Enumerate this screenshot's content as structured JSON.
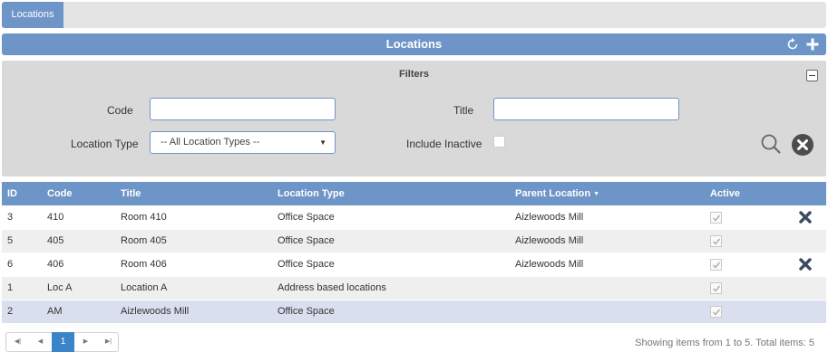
{
  "tabbar": {
    "tabs": [
      {
        "label": "Locations"
      }
    ]
  },
  "header": {
    "title": "Locations",
    "refresh_icon": "refresh-icon",
    "add_icon": "plus-icon"
  },
  "filters": {
    "title": "Filters",
    "code_label": "Code",
    "code_value": "",
    "title_label": "Title",
    "title_value": "",
    "location_type_label": "Location Type",
    "location_type_selected": "-- All Location Types --",
    "include_inactive_label": "Include Inactive",
    "include_inactive_checked": false
  },
  "grid": {
    "columns": [
      "ID",
      "Code",
      "Title",
      "Location Type",
      "Parent Location",
      "Active"
    ],
    "sorted_column": "Parent Location",
    "rows": [
      {
        "id": "3",
        "code": "410",
        "title": "Room 410",
        "type": "Office Space",
        "parent": "Aizlewoods Mill",
        "active": true,
        "deletable": true
      },
      {
        "id": "5",
        "code": "405",
        "title": "Room 405",
        "type": "Office Space",
        "parent": "Aizlewoods Mill",
        "active": true,
        "deletable": false
      },
      {
        "id": "6",
        "code": "406",
        "title": "Room 406",
        "type": "Office Space",
        "parent": "Aizlewoods Mill",
        "active": true,
        "deletable": true
      },
      {
        "id": "1",
        "code": "Loc A",
        "title": "Location A",
        "type": "Address based locations",
        "parent": "",
        "active": true,
        "deletable": false
      },
      {
        "id": "2",
        "code": "AM",
        "title": "Aizlewoods Mill",
        "type": "Office Space",
        "parent": "",
        "active": true,
        "deletable": false
      }
    ]
  },
  "pager": {
    "current_page": "1",
    "info": "Showing items from 1 to 5. Total items: 5"
  },
  "colors": {
    "accent": "#6e95c8",
    "pager_active": "#3a84c8",
    "delete": "#3b4a5c"
  }
}
